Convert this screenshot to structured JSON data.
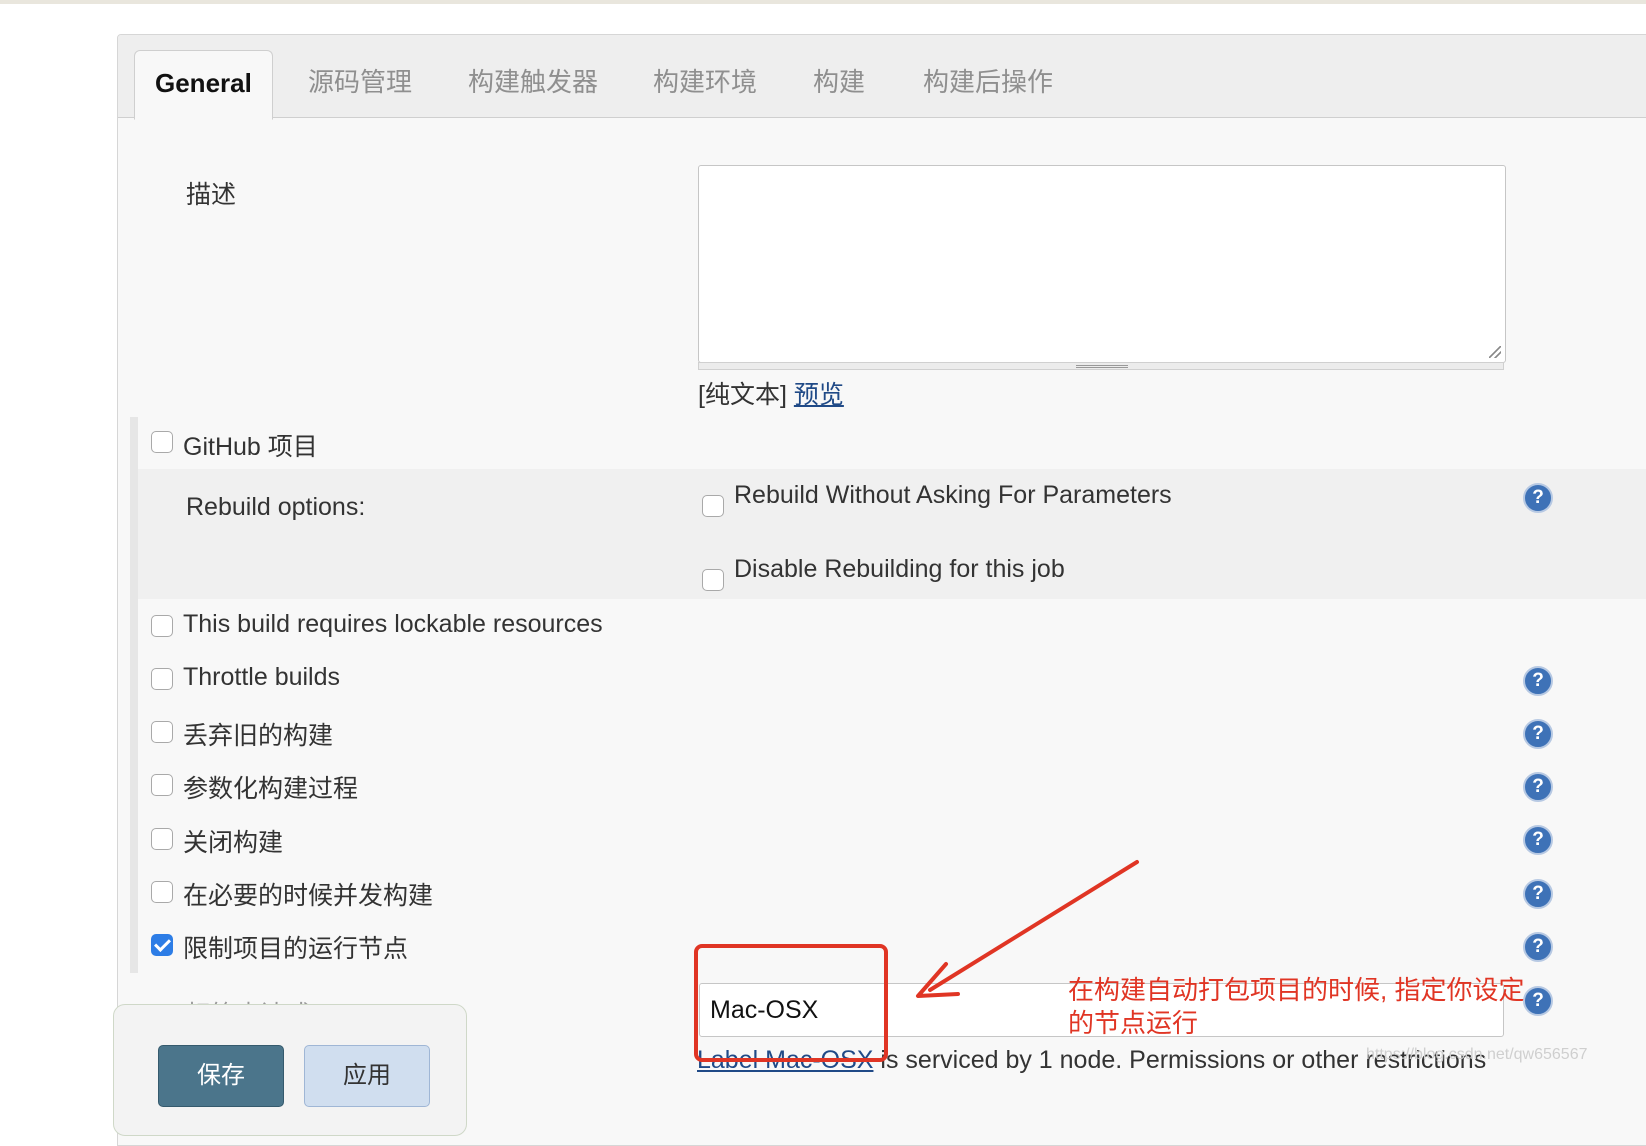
{
  "tabs": {
    "general": "General",
    "scm": "源码管理",
    "triggers": "构建触发器",
    "environment": "构建环境",
    "build": "构建",
    "post_build": "构建后操作"
  },
  "description": {
    "label": "描述",
    "format_text": "[纯文本]",
    "preview_link": "预览"
  },
  "options": {
    "github_project": "GitHub 项目",
    "rebuild_label": "Rebuild options:",
    "rebuild_without_asking": "Rebuild Without Asking For Parameters",
    "disable_rebuilding": "Disable Rebuilding for this job",
    "lockable_resources": "This build requires lockable resources",
    "throttle_builds": "Throttle builds",
    "discard_old_builds": "丢弃旧的构建",
    "parameterized": "参数化构建过程",
    "disable_build": "关闭构建",
    "concurrent_builds": "在必要的时候并发构建",
    "restrict_node": "限制项目的运行节点",
    "restrict_node_checked": true
  },
  "label_expression": {
    "label": "标签表达式",
    "value": "Mac-OSX",
    "status_link": "Label Mac-OSX",
    "status_text": " is serviced by 1 node. Permissions or other restrictions"
  },
  "annotation": {
    "line1": "在构建自动打包项目的时候, 指定你设定",
    "line2": "的节点运行",
    "color": "#e03524"
  },
  "buttons": {
    "save": "保存",
    "apply": "应用"
  },
  "help_icon_glyph": "?",
  "watermark": "https://blog.csdn.net/qw656567"
}
